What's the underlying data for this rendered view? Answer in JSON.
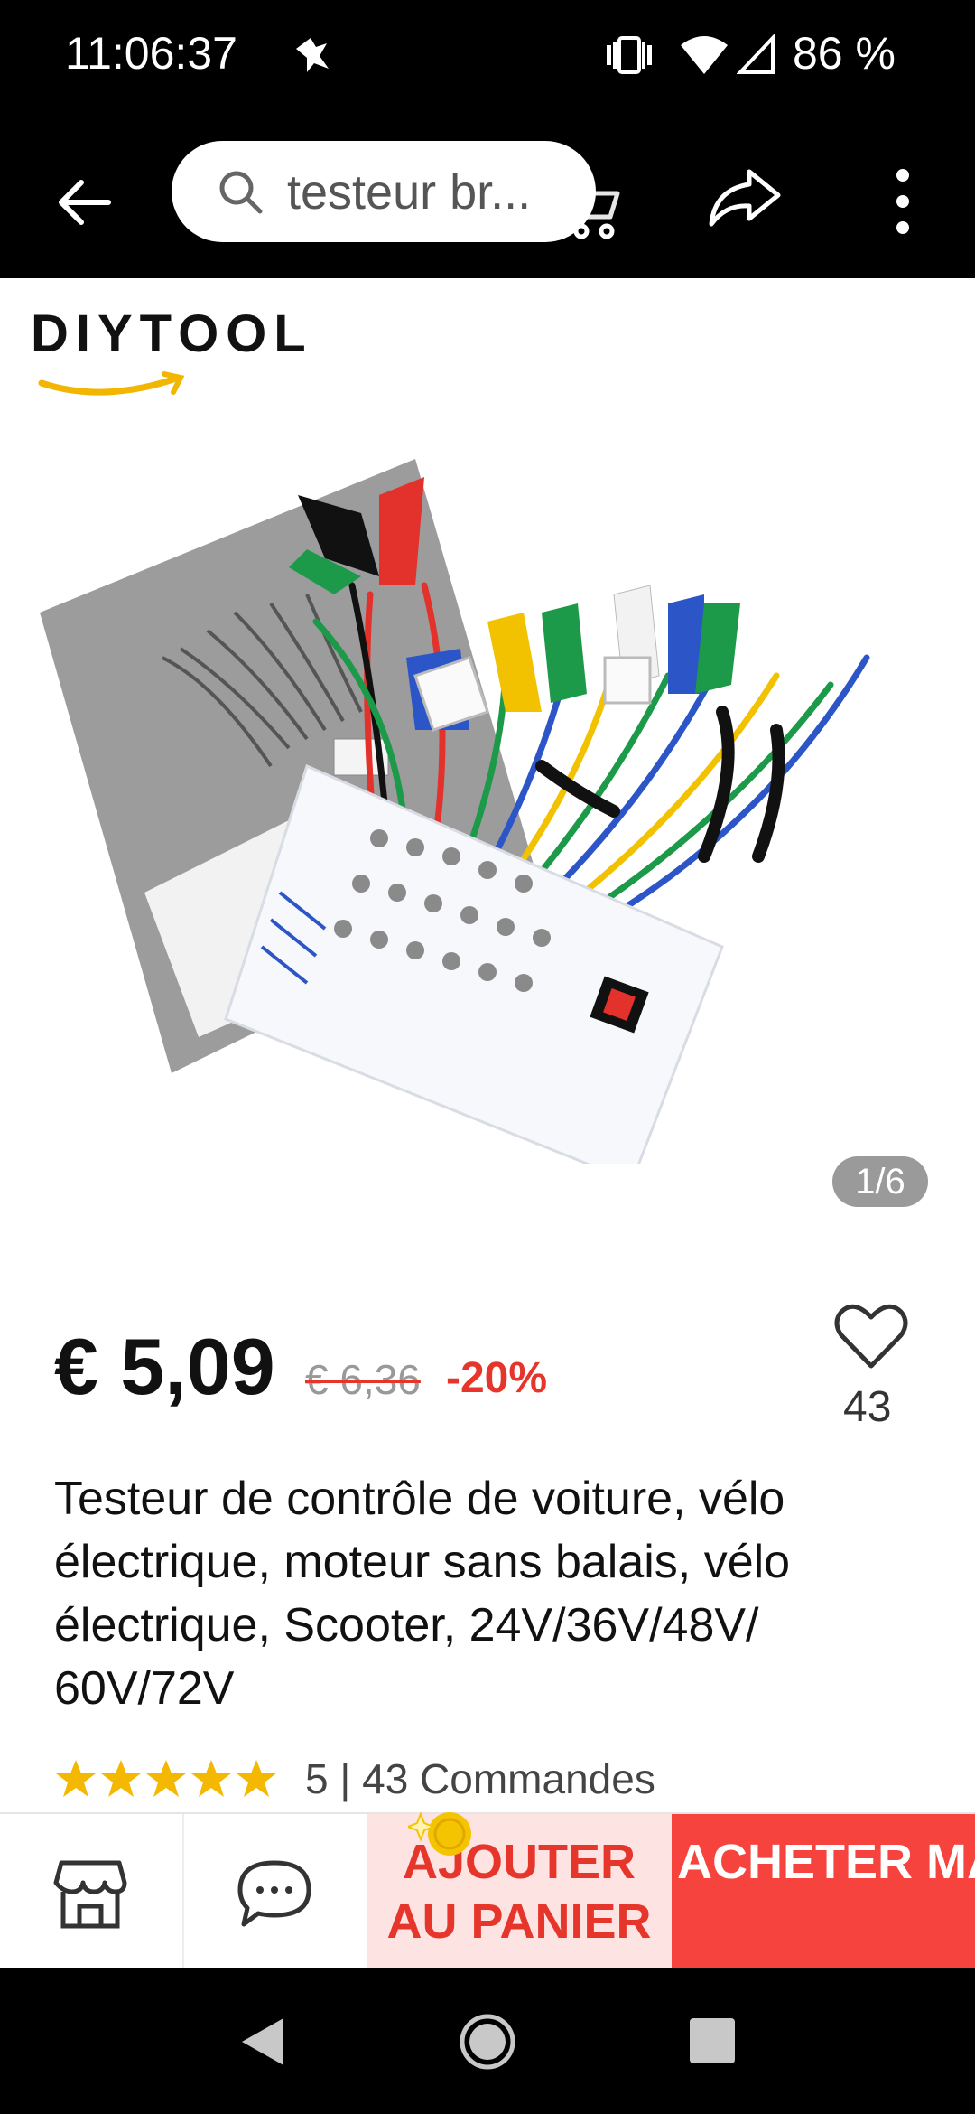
{
  "status_bar": {
    "time": "11:06:37",
    "battery": "86 %",
    "icons": [
      "notification-icon",
      "vibrate-icon",
      "wifi-icon",
      "signal-icon"
    ]
  },
  "top_bar": {
    "search_text": "testeur br...",
    "icons": [
      "back-arrow-icon",
      "search-icon",
      "cart-icon",
      "share-icon",
      "more-vert-icon"
    ]
  },
  "product_image": {
    "brand": "DIYTOOL",
    "counter": "1/6"
  },
  "price": {
    "current": "€ 5,09",
    "original": "€ 6,36",
    "discount": "-20%",
    "favorites": "43"
  },
  "product": {
    "title": "Testeur de contrôle de voiture, vélo électrique, moteur sans balais, vélo électrique, Scooter, 24V/36V/48V/ 60V/72V",
    "rating": "5",
    "rating_stars": 5,
    "orders": "43 Commandes"
  },
  "actions": {
    "add_to_cart": "AJOUTER AU PANIER",
    "buy_now": "ACHETER MAINTENANT",
    "icons": [
      "store-icon",
      "chat-icon"
    ]
  },
  "colors": {
    "accent": "#e6352b",
    "buy_button": "#f6433d",
    "cart_button_bg": "#fde3e1",
    "star": "#f5b800"
  }
}
